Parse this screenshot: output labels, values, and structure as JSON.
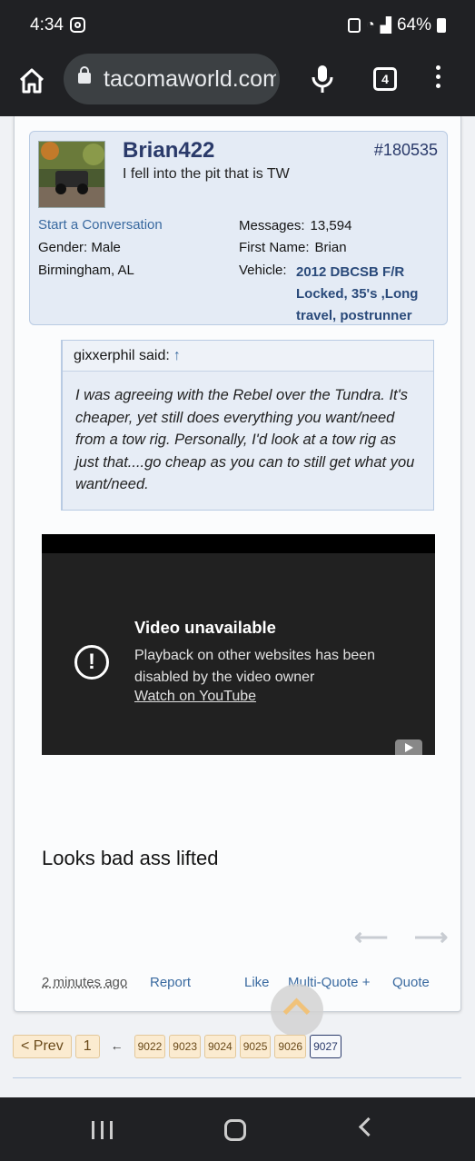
{
  "status_bar": {
    "time": "4:34",
    "battery": "64%"
  },
  "browser": {
    "url": "tacomaworld.com",
    "tab_count": "4"
  },
  "post": {
    "username": "Brian422",
    "post_number": "#180535",
    "user_title": "I fell into the pit that is TW",
    "start_conversation": "Start a Conversation",
    "gender_label": "Gender:",
    "gender": "Male",
    "location": "Birmingham, AL",
    "messages_label": "Messages:",
    "messages": "13,594",
    "first_name_label": "First Name:",
    "first_name": "Brian",
    "vehicle_label": "Vehicle:",
    "vehicle": "2012 DBCSB F/R Locked, 35's ,Long travel, postrunner",
    "quote": {
      "author": "gixxerphil said:",
      "arrow": "↑",
      "text": "I was agreeing with the Rebel over the Tundra. It's cheaper, yet still does everything you want/need from a tow rig. Personally, I'd look at a tow rig as just that....go cheap as you can to still get what you want/need."
    },
    "video": {
      "title": "Video unavailable",
      "description": "Playback on other websites has been disabled by the video owner",
      "link": "Watch on YouTube"
    },
    "message": "Looks bad ass lifted",
    "footer": {
      "time": "2 minutes ago",
      "report": "Report",
      "like": "Like",
      "multiquote": "Multi-Quote +",
      "quote": "Quote"
    }
  },
  "pagination": {
    "prev": "< Prev",
    "first": "1",
    "ellipsis": "←",
    "pages": [
      "9022",
      "9023",
      "9024",
      "9025",
      "9026"
    ],
    "current": "9027"
  },
  "colors": {
    "accent": "#2a3a6a",
    "link": "#3a6aa0",
    "user_block_bg": "#e4ebf5",
    "pager_bg": "#fbebd0"
  }
}
